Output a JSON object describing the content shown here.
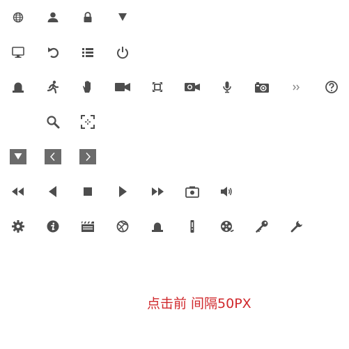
{
  "caption": "点击前 间隔50PX",
  "colors": {
    "icon": "#4d4d4d",
    "iconLight": "#6b6b6b",
    "caption": "#d0282c",
    "background": "#ffffff"
  },
  "icon_rows": [
    [
      "globe-icon",
      "user-icon",
      "lock-icon",
      "triangle-down-icon"
    ],
    [
      "monitor-icon",
      "undo-icon",
      "list-icon",
      "power-icon"
    ],
    [
      "alarm-light-icon",
      "running-person-icon",
      "hand-icon",
      "video-camera-icon",
      "focus-frame-icon",
      "camera-video-icon",
      "microphone-icon",
      "photo-camera-icon",
      "double-chevron-right-icon",
      "help-icon"
    ],
    [
      "search-icon",
      "capture-icon"
    ],
    [
      "dropdown-box-icon",
      "prev-box-icon",
      "next-box-icon"
    ],
    [
      "rewind-icon",
      "play-back-icon",
      "stop-icon",
      "play-icon",
      "fast-forward-icon",
      "snapshot-icon",
      "volume-icon"
    ],
    [
      "settings-gear-icon",
      "info-icon",
      "clapperboard-icon",
      "network-icon",
      "alarm-icon",
      "alert-icon",
      "film-reel-icon",
      "key-icon",
      "wrench-icon"
    ]
  ]
}
